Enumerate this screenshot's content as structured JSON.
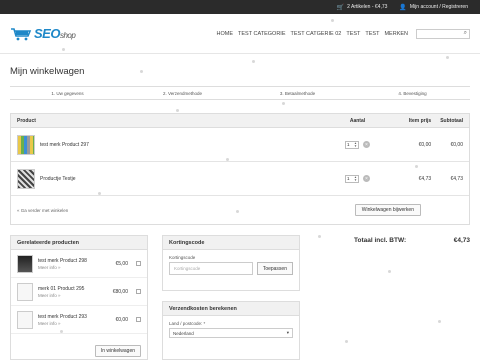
{
  "topbar": {
    "cart_text": "2 Artikelen - €4,73",
    "account_text": "Mijn account / Registreren"
  },
  "logo": {
    "brand": "SEO",
    "suffix": "shop",
    "color": "#1e88c8"
  },
  "nav": {
    "items": [
      "HOME",
      "TEST CATEGORIE",
      "TEST CATGERIE 02",
      "TEST",
      "TEST",
      "MERKEN"
    ]
  },
  "page": {
    "title": "Mijn winkelwagen"
  },
  "steps": [
    "1. Uw gegevens",
    "2. Verzendmethode",
    "3. Betaalmethode",
    "4. Bevestiging"
  ],
  "cart": {
    "headers": {
      "product": "Product",
      "qty": "Aantal",
      "price": "Item prijs",
      "subtotal": "Subtotaal"
    },
    "rows": [
      {
        "name": "test merk Product 297",
        "qty": "1",
        "price": "€0,00",
        "subtotal": "€0,00"
      },
      {
        "name": "Productje Testje",
        "qty": "1",
        "price": "€4,73",
        "subtotal": "€4,73"
      }
    ],
    "continue_link": "« Ga verder met winkelen",
    "update_button": "Winkelwagen bijwerken"
  },
  "related": {
    "title": "Gerelateerde producten",
    "items": [
      {
        "name": "test merk Product 298",
        "more": "Meer info »",
        "price": "€5,00"
      },
      {
        "name": "merk 01 Product 295",
        "more": "Meer info »",
        "price": "€80,00"
      },
      {
        "name": "test merk Product 293",
        "more": "Meer info »",
        "price": "€0,00"
      }
    ],
    "button": "In winkelwagen"
  },
  "coupon": {
    "title": "Kortingscode",
    "label": "Kortingscode",
    "placeholder": "Kortingscode",
    "button": "Toepassen"
  },
  "shipping": {
    "title": "Verzendkosten berekenen",
    "label": "Land / postcode: *",
    "country": "Nederland"
  },
  "totals": {
    "label": "Totaal incl. BTW:",
    "value": "€4,73"
  }
}
